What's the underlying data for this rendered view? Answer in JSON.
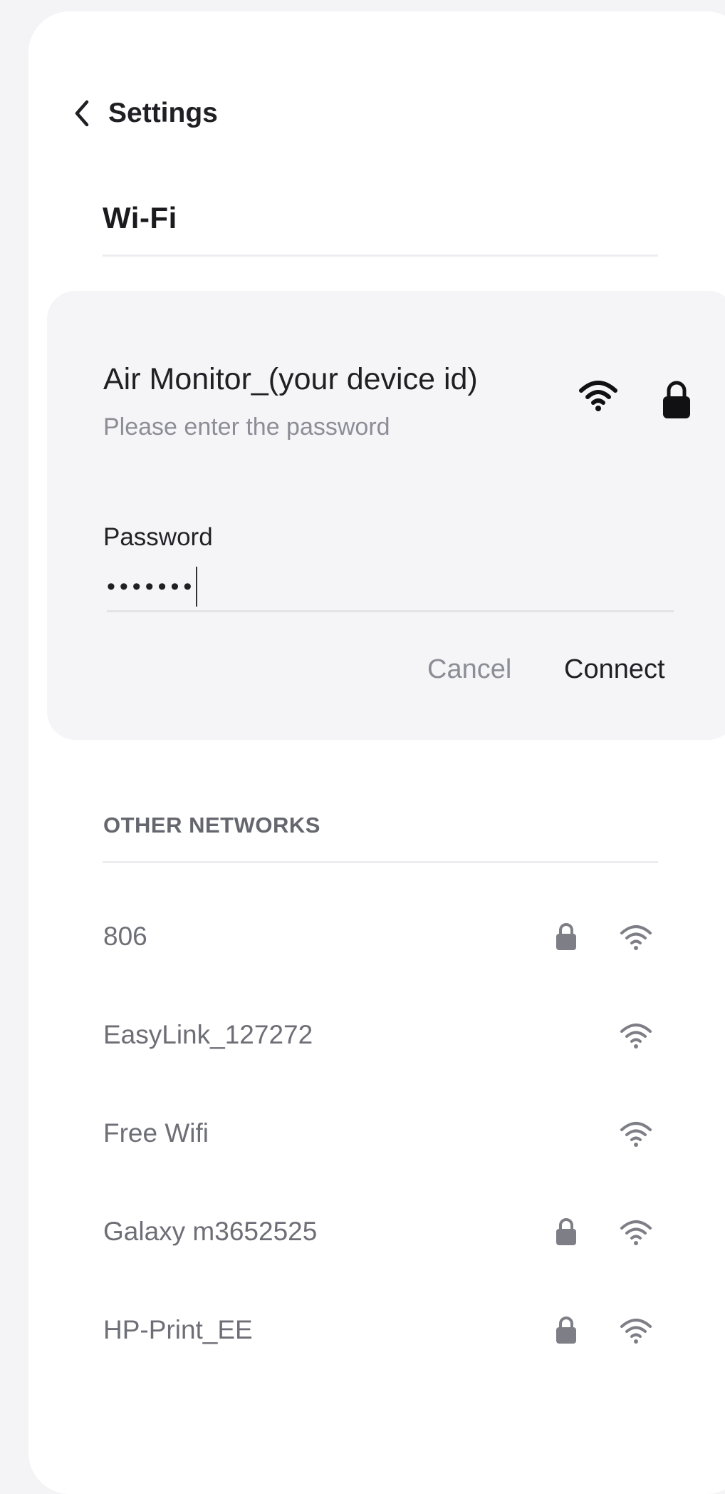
{
  "header": {
    "back_label": "Settings",
    "title": "Wi-Fi"
  },
  "selected_network": {
    "name": "Air Monitor_(your device id)",
    "hint": "Please enter the password",
    "password_label": "Password",
    "password_value": "•••••••",
    "cancel_label": "Cancel",
    "connect_label": "Connect",
    "icons": [
      "wifi-icon",
      "lock-icon"
    ]
  },
  "other_networks": {
    "header": "OTHER NETWORKS",
    "items": [
      {
        "name": "806",
        "locked": true
      },
      {
        "name": "EasyLink_127272",
        "locked": false
      },
      {
        "name": "Free Wifi",
        "locked": false
      },
      {
        "name": "Galaxy m3652525",
        "locked": true
      },
      {
        "name": "HP-Print_EE",
        "locked": true
      }
    ]
  },
  "colors": {
    "page_background": "#f4f4f6",
    "card_background": "#ffffff",
    "panel_background": "#f5f5f8",
    "primary_text": "#1f1f24",
    "secondary_text": "#8d8d96",
    "list_icon_color": "#7e7e86"
  }
}
